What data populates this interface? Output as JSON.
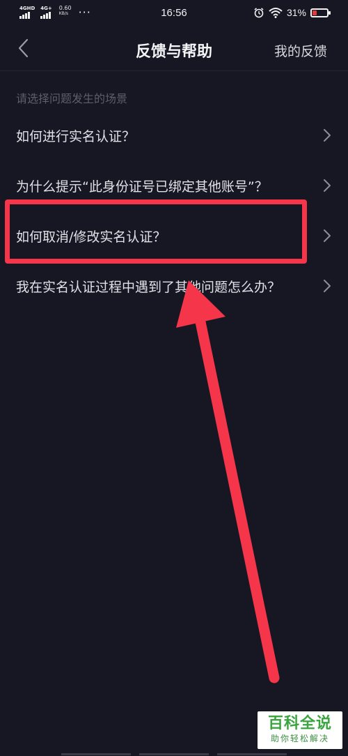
{
  "status_bar": {
    "network1": "4GHD",
    "network2": "4G+",
    "speed_value": "0.60",
    "speed_unit": "KB/s",
    "more": "···",
    "time": "16:56",
    "battery_percent": "31%",
    "battery_level": 0.31,
    "icons": [
      "signal-icon",
      "alarm-icon",
      "wifi-icon",
      "battery-icon"
    ]
  },
  "navbar": {
    "back_icon": "chevron-left-icon",
    "title": "反馈与帮助",
    "right_link": "我的反馈"
  },
  "section_hint": "请选择问题发生的场景",
  "items": [
    {
      "label": "如何进行实名认证？",
      "icon": "chevron-right-icon"
    },
    {
      "label": "为什么提示“此身份证号已绑定其他账号”？",
      "icon": "chevron-right-icon"
    },
    {
      "label": "如何取消/修改实名认证？",
      "icon": "chevron-right-icon"
    },
    {
      "label": "我在实名认证过程中遇到了其他问题怎么办？",
      "icon": "chevron-right-icon"
    }
  ],
  "annotation": {
    "highlight_color": "#f4354a",
    "highlighted_item_index": 2
  },
  "watermark": {
    "title": "百科全说",
    "subtitle": "助你轻松解决",
    "color": "#3aa53f"
  },
  "colors": {
    "background": "#161722",
    "text": "#e1e2e8",
    "hint": "#5c5e6c"
  }
}
